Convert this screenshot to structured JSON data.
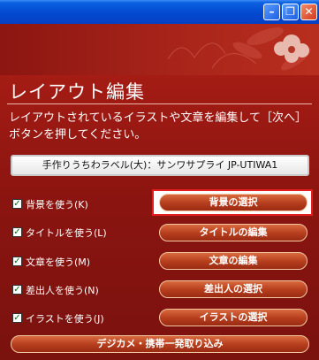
{
  "window": {
    "minimize_icon": "minimize-icon",
    "restore_icon": "restore-icon",
    "close_icon": "close-icon"
  },
  "header": {
    "title": "レイアウト編集",
    "description": "レイアウトされているイラストや文章を編集して［次へ］ボタンを押してください。"
  },
  "label_info": "手作りうちわラベル(大)：サンワサプライ  JP-UTIWA1",
  "options": [
    {
      "label": "背景を使う(K)",
      "checked": true,
      "button": "背景の選択"
    },
    {
      "label": "タイトルを使う(L)",
      "checked": true,
      "button": "タイトルの編集"
    },
    {
      "label": "文章を使う(M)",
      "checked": true,
      "button": "文章の編集"
    },
    {
      "label": "差出人を使う(N)",
      "checked": true,
      "button": "差出人の選択"
    },
    {
      "label": "イラストを使う(J)",
      "checked": true,
      "button": "イラストの選択"
    }
  ],
  "bottom_button": "デジカメ・携帯一発取り込み",
  "colors": {
    "panel": "#8e1a14",
    "highlight_border": "#e41e1e"
  }
}
